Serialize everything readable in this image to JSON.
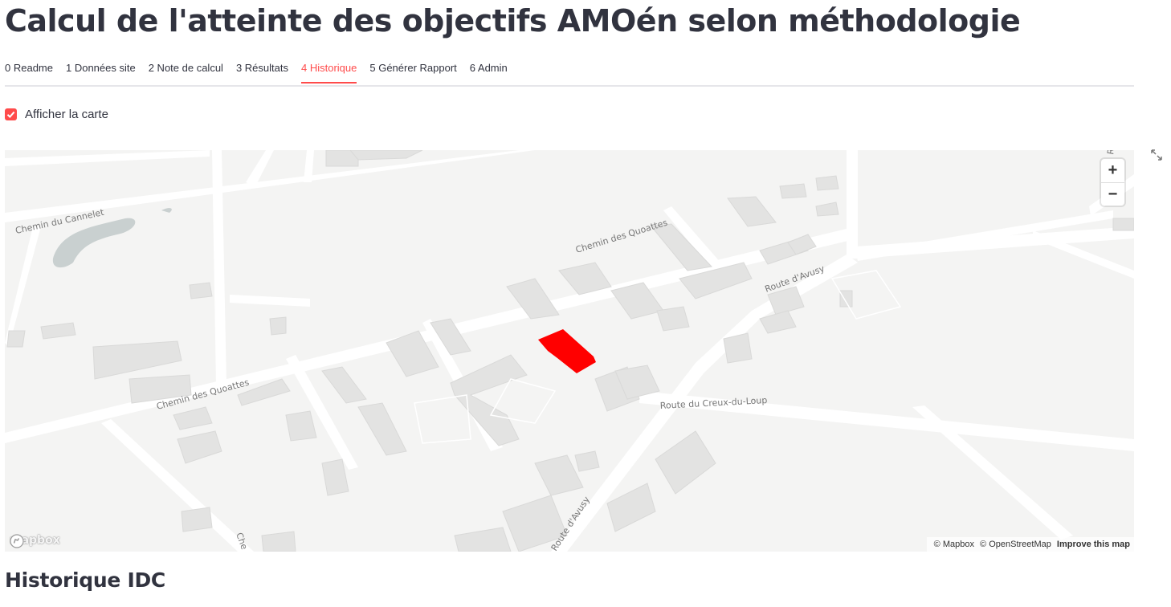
{
  "page": {
    "title": "Calcul de l'atteinte des objectifs AMOén selon méthodologie",
    "accent_color": "#ff4b4b"
  },
  "tabs": [
    {
      "label": "0 Readme",
      "active": false
    },
    {
      "label": "1 Données site",
      "active": false
    },
    {
      "label": "2 Note de calcul",
      "active": false
    },
    {
      "label": "3 Résultats",
      "active": false
    },
    {
      "label": "4 Historique",
      "active": true
    },
    {
      "label": "5 Générer Rapport",
      "active": false
    },
    {
      "label": "6 Admin",
      "active": false
    }
  ],
  "map_toggle": {
    "label": "Afficher la carte",
    "checked": true
  },
  "map": {
    "highlight_color": "#ff0000",
    "street_labels": {
      "cannelet": "Chemin du Cannelet",
      "quoattes_north": "Chemin des Quoattes",
      "quoattes_south": "Chemin des Quoattes",
      "avusy_north": "Route d'Avusy",
      "avusy_south": "Route d'Avusy",
      "creux_du_loup": "Route du Creux-du-Loup",
      "chemin_partial": "Che",
      "r_partial": "R"
    },
    "zoom_in_label": "+",
    "zoom_out_label": "−",
    "logo_text": "mapbox",
    "attribution": {
      "mapbox": "© Mapbox",
      "osm": "© OpenStreetMap",
      "improve": "Improve this map"
    },
    "fullscreen_icon": "expand-arrows-icon"
  },
  "section": {
    "heading": "Historique IDC"
  }
}
